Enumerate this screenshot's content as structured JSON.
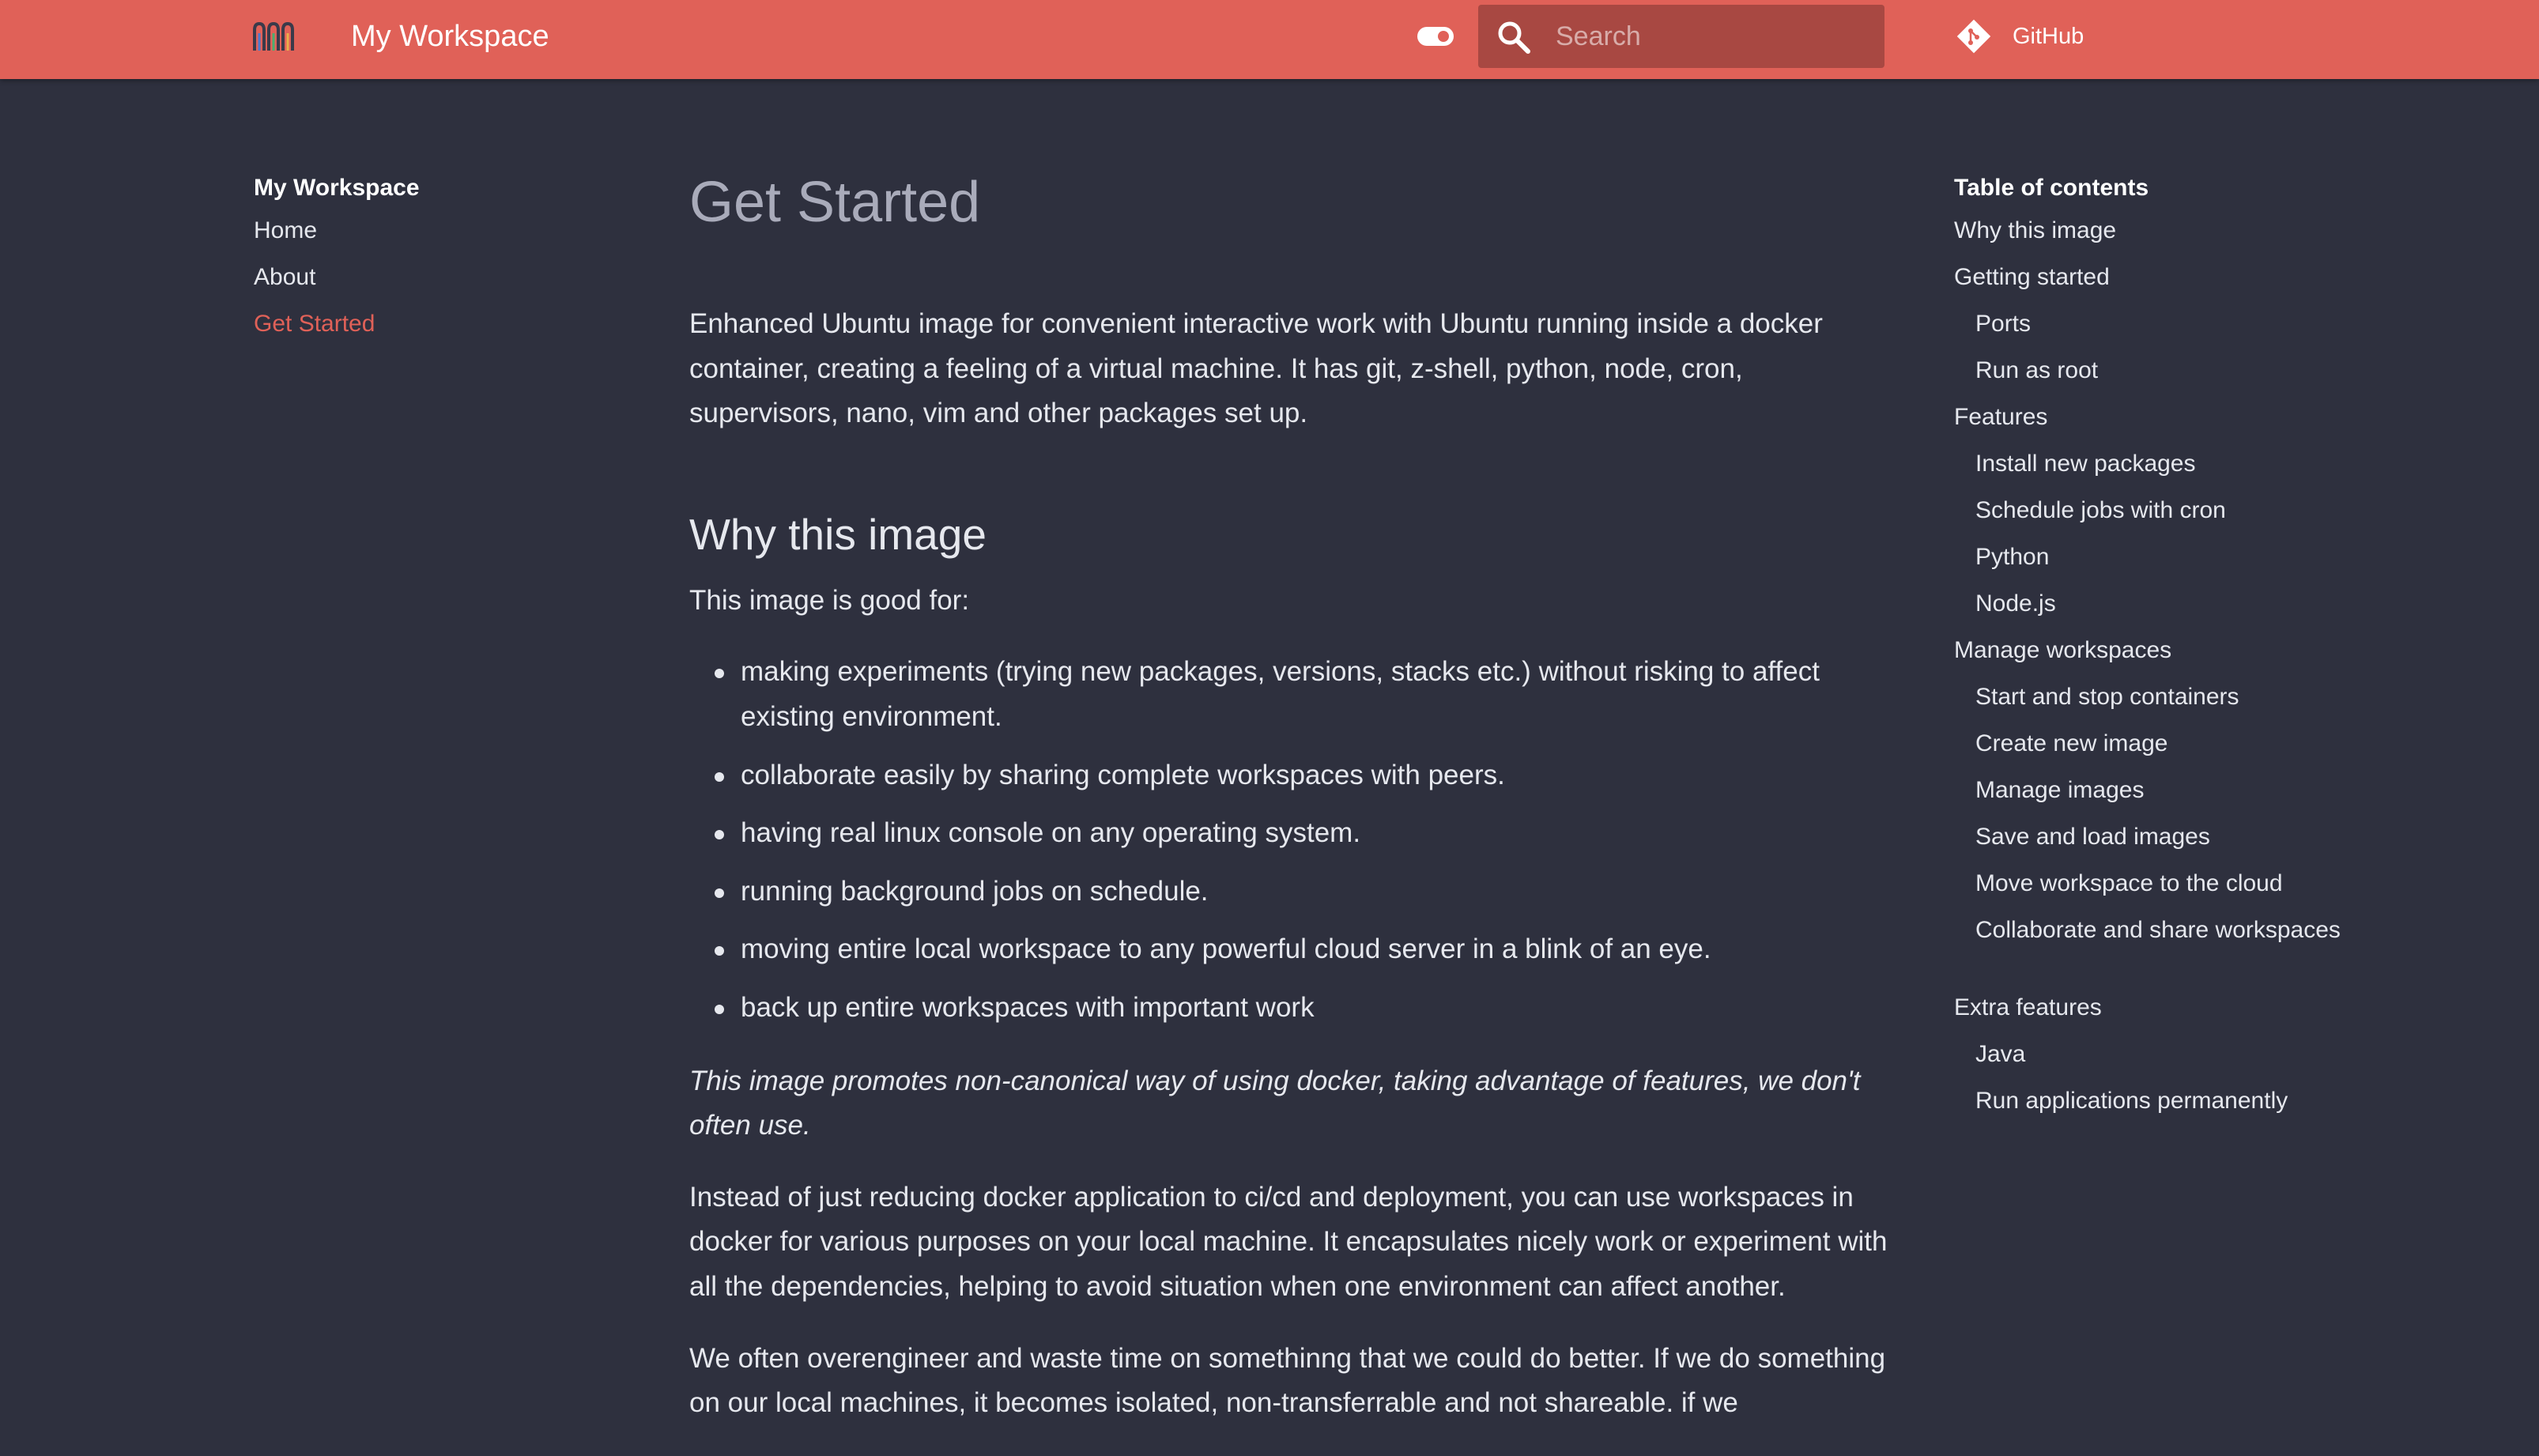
{
  "header": {
    "logo_icon": "workspace-logo-icon",
    "title": "My Workspace",
    "theme_toggle_icon": "toggle-icon",
    "search_icon": "search-icon",
    "search_placeholder": "Search",
    "github_icon": "git-diamond-icon",
    "github_label": "GitHub",
    "accent_color": "#e06158",
    "background_color": "#2e303e"
  },
  "left_nav": {
    "title": "My Workspace",
    "items": [
      {
        "label": "Home"
      },
      {
        "label": "About"
      },
      {
        "label": "Get Started",
        "active": true
      }
    ]
  },
  "content": {
    "title": "Get Started",
    "intro": "Enhanced Ubuntu image for convenient interactive work with Ubuntu running inside a docker container, creating a feeling of a virtual machine. It has git, z-shell, python, node, cron, supervisors, nano, vim and other packages set up.",
    "why_heading": "Why this image",
    "good_for": "This image is good for:",
    "bullets": [
      "making experiments (trying new packages, versions, stacks etc.) without risking to affect existing environment.",
      "collaborate easily by sharing complete workspaces with peers.",
      "having real linux console on any operating system.",
      "running background jobs on schedule.",
      "moving entire local workspace to any powerful cloud server in a blink of an eye.",
      "back up entire workspaces with important work"
    ],
    "italic_note": "This image promotes non-canonical way of using docker, taking advantage of features, we don't often use.",
    "instead_para": "Instead of just reducing docker application to ci/cd and deployment, you can use workspaces in docker for various purposes on your local machine. It encapsulates nicely work or experiment with all the dependencies, helping to avoid situation when one environment can affect another.",
    "often_para": "We often overengineer and waste time on somethinng that we could do better. If we do something on our local machines, it becomes isolated, non-transferrable and not shareable. if we"
  },
  "toc": {
    "title": "Table of contents",
    "items": [
      {
        "label": "Why this image",
        "level": 1
      },
      {
        "label": "Getting started",
        "level": 1
      },
      {
        "label": "Ports",
        "level": 2
      },
      {
        "label": "Run as root",
        "level": 2
      },
      {
        "label": "Features",
        "level": 1
      },
      {
        "label": "Install new packages",
        "level": 2
      },
      {
        "label": "Schedule jobs with cron",
        "level": 2
      },
      {
        "label": "Python",
        "level": 2
      },
      {
        "label": "Node.js",
        "level": 2
      },
      {
        "label": "Manage workspaces",
        "level": 1
      },
      {
        "label": "Start and stop containers",
        "level": 2
      },
      {
        "label": "Create new image",
        "level": 2
      },
      {
        "label": "Manage images",
        "level": 2
      },
      {
        "label": "Save and load images",
        "level": 2
      },
      {
        "label": "Move workspace to the cloud",
        "level": 2
      },
      {
        "label": "Collaborate and share workspaces",
        "level": 2
      },
      {
        "label": "Extra features",
        "level": 1
      },
      {
        "label": "Java",
        "level": 2
      },
      {
        "label": "Run applications permanently",
        "level": 2
      }
    ]
  }
}
